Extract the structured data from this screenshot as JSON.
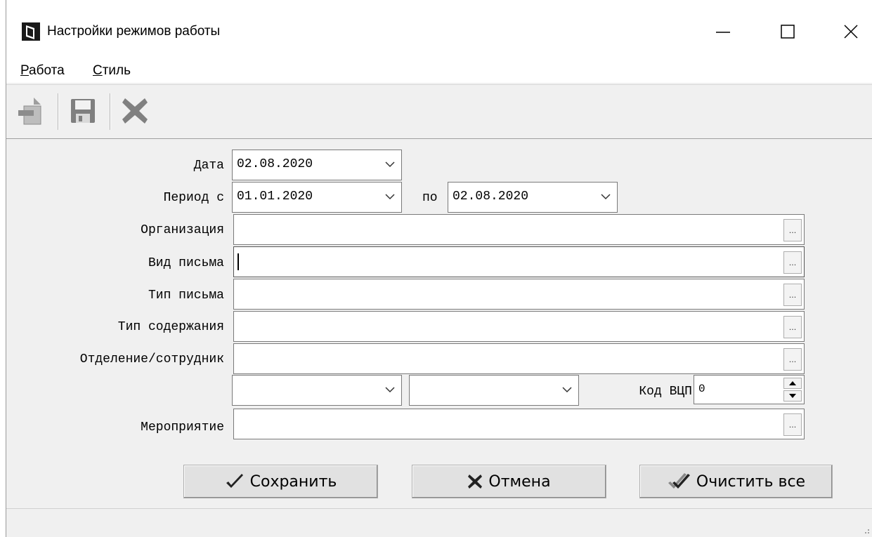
{
  "window": {
    "title": "Настройки режимов работы"
  },
  "menu": [
    {
      "accel": "Р",
      "rest": "абота"
    },
    {
      "accel": "С",
      "rest": "тиль"
    }
  ],
  "toolbar": {
    "icons": [
      "new-record-icon",
      "save-icon",
      "delete-icon"
    ]
  },
  "form": {
    "date_label": "Дата",
    "date_value": "02.08.2020",
    "period_from_label": "Период с",
    "period_from_value": "01.01.2020",
    "period_to_label": "по",
    "period_to_value": "02.08.2020",
    "organization_label": "Организация",
    "organization_value": "",
    "letter_kind_label": "Вид письма",
    "letter_kind_value": "",
    "letter_type_label": "Тип письма",
    "letter_type_value": "",
    "content_type_label": "Тип содержания",
    "content_type_value": "",
    "department_label": "Отделение/сотрудник",
    "department_value": "",
    "combo1_value": "",
    "combo2_value": "",
    "vcp_label": "Код ВЦП",
    "vcp_value": "0",
    "event_label": "Мероприятие",
    "event_value": "",
    "ellipsis": "..."
  },
  "buttons": {
    "save": "Сохранить",
    "cancel": "Отмена",
    "clear_all": "Очистить все"
  },
  "colors": {
    "window_bg": "#f0f0f0",
    "field_border": "#7a7a7a",
    "button_face": "#e1e1e1",
    "icon_gray": "#7f7f7f"
  }
}
